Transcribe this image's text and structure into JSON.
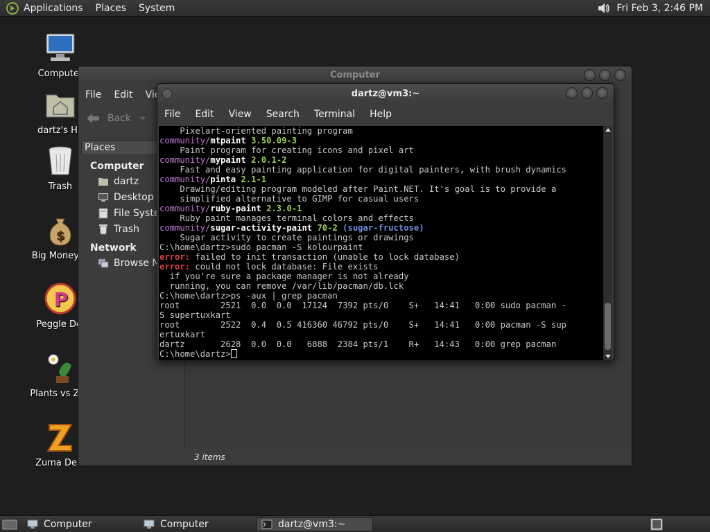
{
  "top_panel": {
    "menus": [
      "Applications",
      "Places",
      "System"
    ],
    "clock": "Fri Feb  3,  2:46 PM"
  },
  "desktop_icons": [
    {
      "label": "Computer",
      "icon": "computer-icon"
    },
    {
      "label": "dartz's Ho",
      "icon": "home-folder-icon"
    },
    {
      "label": "Trash",
      "icon": "trash-icon"
    },
    {
      "label": "Big Money D",
      "icon": "money-bag-icon"
    },
    {
      "label": "Peggle Del",
      "icon": "peggle-icon"
    },
    {
      "label": "Plants vs Zon",
      "icon": "plants-vs-zombies-icon"
    },
    {
      "label": "Zuma Delu",
      "icon": "zuma-icon"
    }
  ],
  "file_manager": {
    "title": "Computer",
    "menu": {
      "file": "File",
      "edit": "Edit",
      "view": "Vie"
    },
    "back_label": "Back",
    "places_label": "Places",
    "sections": {
      "computer": "Computer",
      "network": "Network"
    },
    "computer_items": [
      "dartz",
      "Desktop",
      "File System",
      "Trash"
    ],
    "network_items": [
      "Browse Ne"
    ],
    "status": "3 items"
  },
  "terminal": {
    "title": "dartz@vm3:~",
    "menu": [
      "File",
      "Edit",
      "View",
      "Search",
      "Terminal",
      "Help"
    ],
    "lines": [
      {
        "t": "    Pixelart-oriented painting program"
      },
      {
        "repo": "community/",
        "pkg": "mtpaint",
        "ver": "3.50.09-3"
      },
      {
        "t": "    Paint program for creating icons and pixel art"
      },
      {
        "repo": "community/",
        "pkg": "mypaint",
        "ver": "2.0.1-2"
      },
      {
        "t": "    Fast and easy painting application for digital painters, with brush dynamics"
      },
      {
        "repo": "community/",
        "pkg": "pinta",
        "ver": "2.1-1"
      },
      {
        "t": "    Drawing/editing program modeled after Paint.NET. It's goal is to provide a"
      },
      {
        "t": "    simplified alternative to GIMP for casual users"
      },
      {
        "repo": "community/",
        "pkg": "ruby-paint",
        "ver": "2.3.0-1"
      },
      {
        "t": "    Ruby paint manages terminal colors and effects"
      },
      {
        "repo": "community/",
        "pkg": "sugar-activity-paint",
        "ver": "70-2",
        "grp": "(sugar-fructose)"
      },
      {
        "t": "    Sugar activity to create paintings or drawings"
      },
      {
        "t": "C:\\home\\dartz>sudo pacman -S kolourpaint"
      },
      {
        "err": "error:",
        "t": " failed to init transaction (unable to lock database)"
      },
      {
        "err": "error:",
        "t": " could not lock database: File exists"
      },
      {
        "t": "  if you're sure a package manager is not already"
      },
      {
        "t": "  running, you can remove /var/lib/pacman/db.lck"
      },
      {
        "t": "C:\\home\\dartz>ps -aux | grep pacman"
      },
      {
        "t": "root        2521  0.0  0.0  17124  7392 pts/0    S+   14:41   0:00 sudo pacman -"
      },
      {
        "t": "S supertuxkart"
      },
      {
        "t": "root        2522  0.4  0.5 416360 46792 pts/0    S+   14:41   0:00 pacman -S sup"
      },
      {
        "t": "ertuxkart"
      },
      {
        "t": "dartz       2628  0.0  0.0   6888  2384 pts/1    R+   14:43   0:00 grep pacman"
      },
      {
        "t": "C:\\home\\dartz>",
        "cursor": true
      }
    ]
  },
  "taskbar": {
    "tasks": [
      {
        "label": "Computer",
        "active": false
      },
      {
        "label": "Computer",
        "active": false
      },
      {
        "label": "dartz@vm3:~",
        "active": true
      }
    ]
  }
}
